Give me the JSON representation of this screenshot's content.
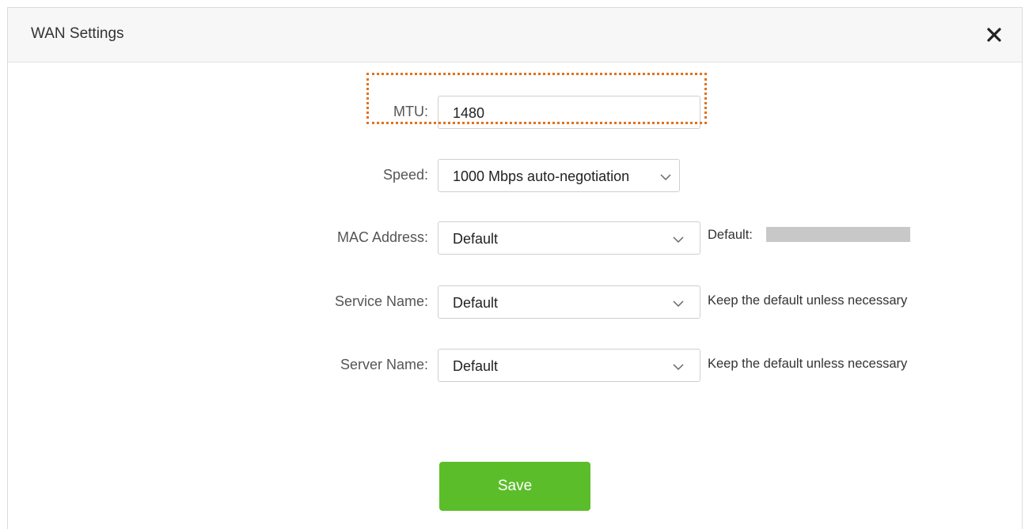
{
  "dialog": {
    "title": "WAN Settings",
    "close_icon": "close-icon"
  },
  "mtu": {
    "label": "MTU:",
    "value": "1480"
  },
  "speed": {
    "label": "Speed:",
    "selected": "1000 Mbps auto-negotiation"
  },
  "mac_address": {
    "label": "MAC Address:",
    "selected": "Default",
    "hint": "Default:"
  },
  "service_name": {
    "label": "Service Name:",
    "selected": "Default",
    "hint": "Keep the default unless necessary"
  },
  "server_name": {
    "label": "Server Name:",
    "selected": "Default",
    "hint": "Keep the default unless necessary"
  },
  "save_button": {
    "label": "Save"
  },
  "colors": {
    "accent_green": "#5cbd2a",
    "highlight_orange": "#e2711d"
  }
}
